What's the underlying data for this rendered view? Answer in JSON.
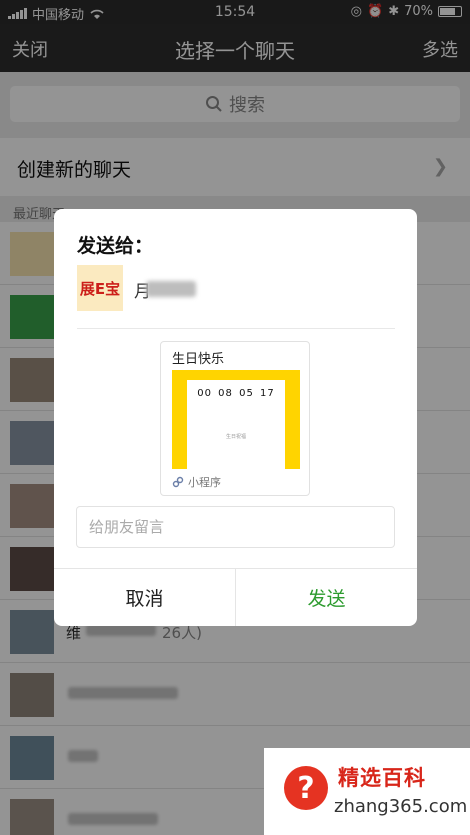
{
  "status_bar": {
    "carrier": "中国移动",
    "time": "15:54",
    "battery": "70%"
  },
  "nav": {
    "close": "关闭",
    "title": "选择一个聊天",
    "multi": "多选"
  },
  "search": {
    "placeholder": "搜索"
  },
  "new_chat": {
    "label": "创建新的聊天"
  },
  "recent_title": "最近聊天",
  "chat_rows": [
    {
      "name": ""
    },
    {
      "name": ""
    },
    {
      "name": ""
    },
    {
      "name": ""
    },
    {
      "name": ""
    },
    {
      "name": ""
    },
    {
      "name": "维",
      "count": "26人)"
    },
    {
      "name": ""
    },
    {
      "name": ""
    },
    {
      "name": ""
    }
  ],
  "dialog": {
    "title": "发送给：",
    "recipient_logo": "展E宝",
    "recipient_name": "月",
    "card": {
      "title": "生日快乐",
      "countdown": "00 08 05 17",
      "small_text": "生日祝福",
      "footer": "小程序"
    },
    "message_placeholder": "给朋友留言",
    "cancel": "取消",
    "send": "发送"
  },
  "watermark": {
    "brand": "精选百科",
    "domain": "zhang365.com"
  },
  "colors": {
    "send_green": "#2d9b2f",
    "card_yellow": "#ffd400",
    "logo_red": "#cc1f1a"
  }
}
